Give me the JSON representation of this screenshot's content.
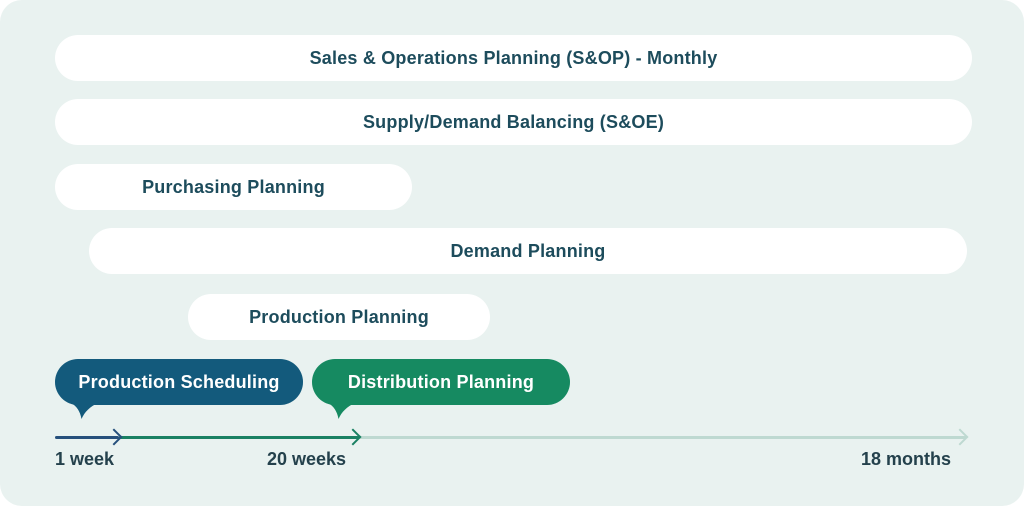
{
  "colors": {
    "canvas-bg": "#e9f2f0",
    "pill-white": "#ffffff",
    "pill-text": "#1d4c5c",
    "pill-blue": "#135a7c",
    "pill-green": "#168a61",
    "pill-colored-text": "#ffffff",
    "tl-navy": "#26507c",
    "tl-green": "#1a8163",
    "tl-pale": "#bed9d1",
    "tl-label": "#24414c"
  },
  "bars": [
    {
      "label": "Sales & Operations Planning (S&OP) - Monthly",
      "variant": "white"
    },
    {
      "label": "Supply/Demand Balancing (S&OE)",
      "variant": "white"
    },
    {
      "label": "Purchasing Planning",
      "variant": "white"
    },
    {
      "label": "Demand Planning",
      "variant": "white"
    },
    {
      "label": "Production Planning",
      "variant": "white"
    },
    {
      "label": "Production Scheduling",
      "variant": "blue"
    },
    {
      "label": "Distribution Planning",
      "variant": "green"
    }
  ],
  "timeline": {
    "markers": [
      {
        "label": "1 week"
      },
      {
        "label": "20 weeks"
      },
      {
        "label": "18 months"
      }
    ]
  }
}
